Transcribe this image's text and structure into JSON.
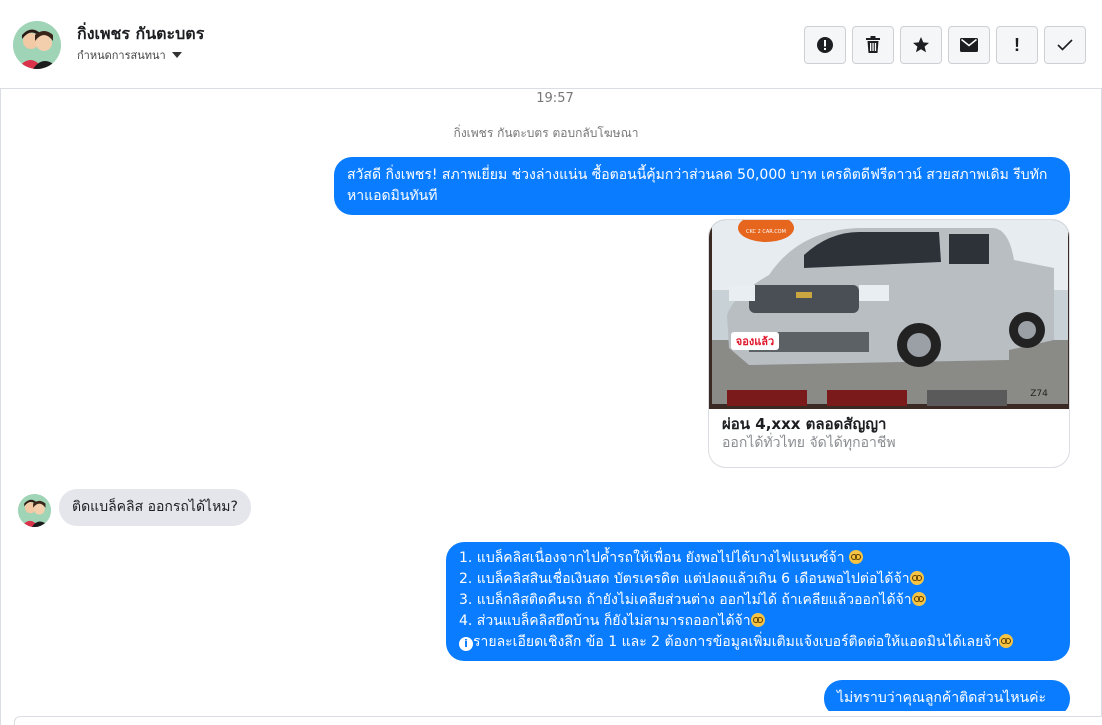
{
  "header": {
    "contact_name": "กิ่งเพชร กันตะบตร",
    "subtitle": "กำหนดการสนทนา",
    "actions": [
      {
        "name": "spam",
        "icon": "alert-circle-icon"
      },
      {
        "name": "delete",
        "icon": "trash-icon"
      },
      {
        "name": "star",
        "icon": "star-icon"
      },
      {
        "name": "mark-unread",
        "icon": "envelope-icon"
      },
      {
        "name": "follow-up",
        "icon": "exclamation-icon",
        "glyph": "!"
      },
      {
        "name": "done",
        "icon": "check-icon"
      }
    ]
  },
  "thread": {
    "timestamp": "19:57",
    "note": "กิ่งเพชร กันตะบตร ตอบกลับโฆษณา",
    "message1": "สวัสดี กิ่งเพชร!  สภาพเยี่ยม ช่วงล่างแน่น  ซื้อตอนนี้คุ้มกว่าส่วนลด 50,000 บาท เครดิตดีฟรีดาวน์  สวยสภาพเดิม รีบทักหาแอดมินทันที",
    "ad_card": {
      "title": "ผ่อน 4,xxx ตลอดสัญญา",
      "subtitle": "ออกได้ทั่วไทย จัดได้ทุกอาชีพ",
      "image_logo_text": "CKC 2 CAR.COM",
      "image_badge_text": "จองแล้ว",
      "image_code": "Z74"
    },
    "incoming1": "ติดแบล็คลิส ออกรถได้ไหม?",
    "reply_lines": [
      "1. แบล็คลิสเนื่องจากไปค้ำรถให้เพื่อน ยังพอไปได้บางไฟแนนซ์จ้า",
      "2. แบล็คลิสสินเชื่อเงินสด บัตรเครดิต แต่ปลดแล้วเกิน 6 เดือนพอไปต่อได้จ้า",
      "3. แบล็กลิสติดคืนรถ ถ้ายังไม่เคลียส่วนต่าง ออกไม่ได้ ถ้าเคลียแล้วออกได้จ้า",
      "4. ส่วนแบล็คลิสยึดบ้าน ก็ยังไม่สามารถออกได้จ้า",
      "รายละเอียดเชิงลึก ข้อ 1 และ 2 ต้องการข้อมูลเพิ่มเติมแจ้งเบอร์ติดต่อให้แอดมินได้เลยจ้า"
    ],
    "message3": "ไม่ทราบว่าคุณลูกค้าติดส่วนไหนค่ะ"
  },
  "colors": {
    "outgoing_bubble": "#0a7cff",
    "incoming_bubble": "#e4e6eb"
  }
}
